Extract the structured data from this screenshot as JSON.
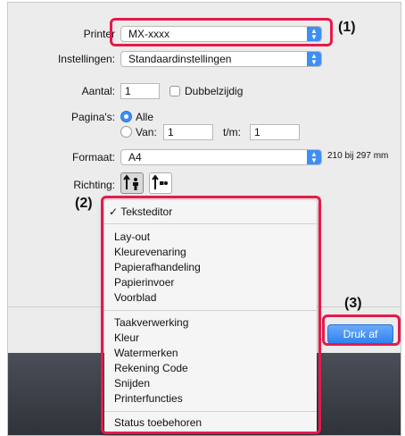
{
  "form": {
    "printer_label": "Printer",
    "printer_value": "MX-xxxx",
    "settings_label": "Instellingen:",
    "settings_value": "Standaardinstellingen",
    "copies_label": "Aantal:",
    "copies_value": "1",
    "duplex_label": "Dubbelzijdig",
    "pages_label": "Pagina's:",
    "all_label": "Alle",
    "from_label": "Van:",
    "from_value": "1",
    "to_label": "t/m:",
    "to_value": "1",
    "format_label": "Formaat:",
    "format_value": "A4",
    "format_size": "210 bij 297 mm",
    "orientation_label": "Richting:"
  },
  "menu": {
    "checked_item": "Teksteditor",
    "groups": [
      [
        "Lay-out",
        "Kleurevenaring",
        "Papierafhandeling",
        "Papierinvoer",
        "Voorblad"
      ],
      [
        "Taakverwerking",
        "Kleur",
        "Watermerken",
        "Rekening Code",
        "Snijden",
        "Printerfuncties"
      ],
      [
        "Status toebehoren"
      ]
    ]
  },
  "print_button": "Druk af",
  "callouts": {
    "c1": "(1)",
    "c2": "(2)",
    "c3": "(3)"
  },
  "colors": {
    "accent": "#3d8ef7",
    "highlight": "#e51a4b"
  },
  "icons": {
    "popup": "up-down-arrows-icon",
    "orientation": "portrait-and-landscape-icons"
  }
}
